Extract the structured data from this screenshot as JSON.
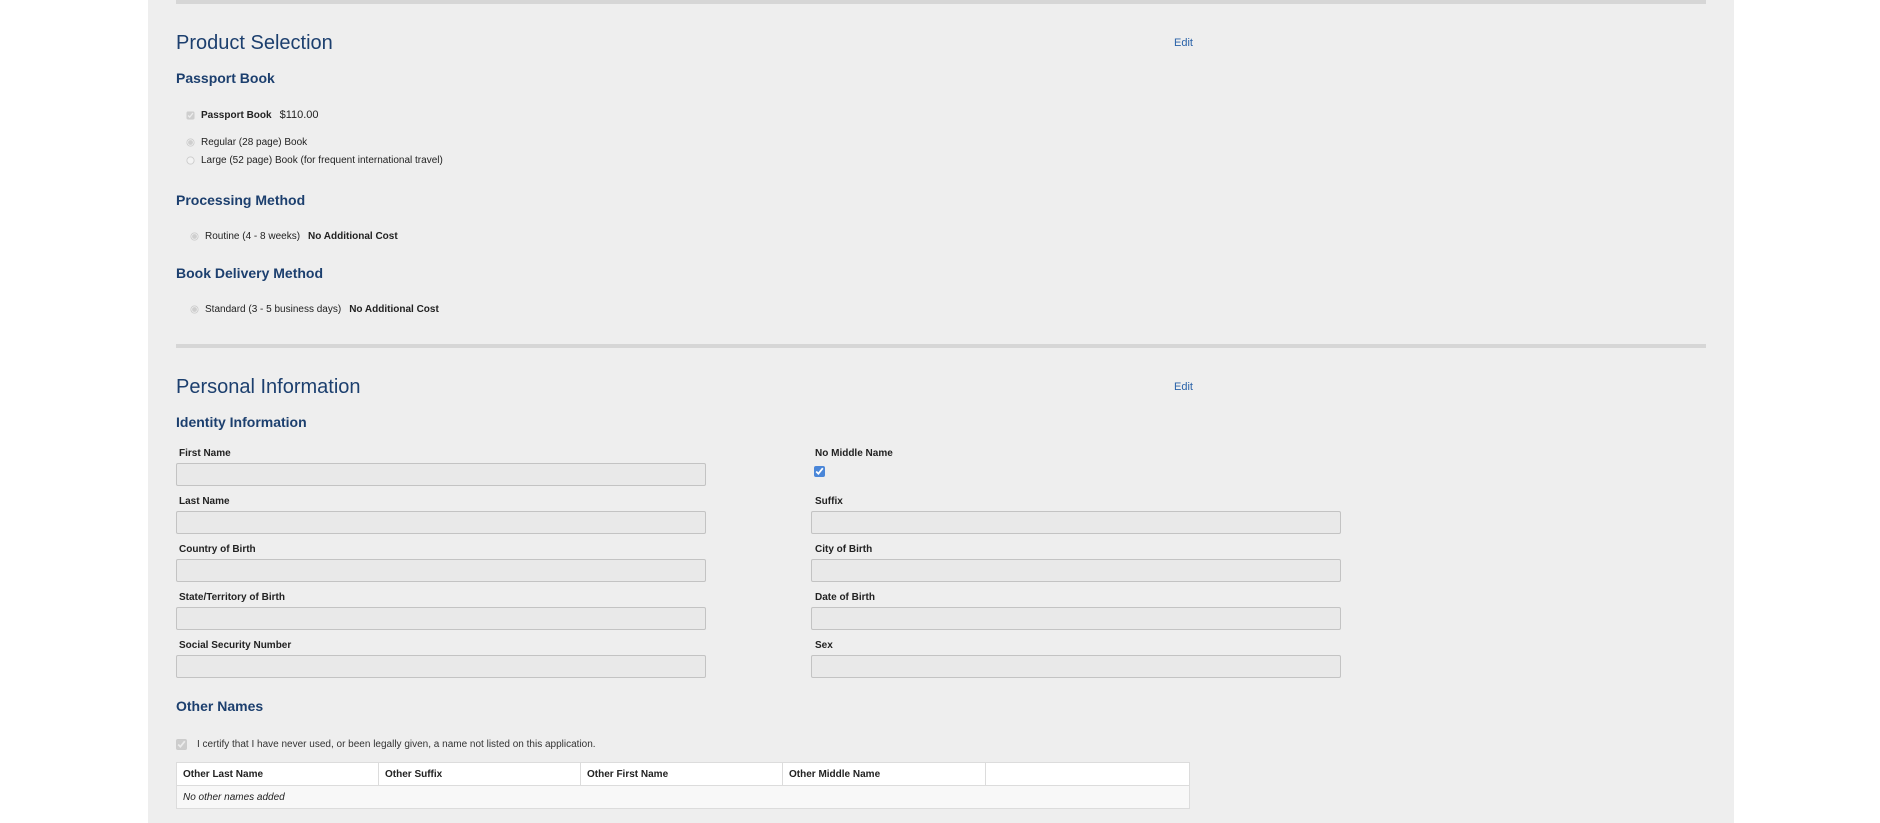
{
  "product_selection": {
    "title": "Product Selection",
    "edit_label": "Edit",
    "passport_book": {
      "title": "Passport Book",
      "item_label": "Passport Book",
      "item_price": "$110.00",
      "options": [
        "Regular (28 page) Book",
        "Large (52 page) Book (for frequent international travel)"
      ]
    },
    "processing_method": {
      "title": "Processing Method",
      "option_label": "Routine (4 - 8 weeks)",
      "option_cost": "No Additional Cost"
    },
    "delivery_method": {
      "title": "Book Delivery Method",
      "option_label": "Standard (3 - 5 business days)",
      "option_cost": "No Additional Cost"
    }
  },
  "personal_information": {
    "title": "Personal Information",
    "edit_label": "Edit",
    "identity": {
      "title": "Identity Information",
      "first_name_label": "First Name",
      "no_middle_name_label": "No Middle Name",
      "last_name_label": "Last Name",
      "suffix_label": "Suffix",
      "country_of_birth_label": "Country of Birth",
      "city_of_birth_label": "City of Birth",
      "state_of_birth_label": "State/Territory of Birth",
      "date_of_birth_label": "Date of Birth",
      "ssn_label": "Social Security Number",
      "sex_label": "Sex"
    },
    "other_names": {
      "title": "Other Names",
      "certify_text": "I certify that I have never used, or been legally given, a name not listed on this application.",
      "columns": [
        "Other Last Name",
        "Other Suffix",
        "Other First Name",
        "Other Middle Name",
        ""
      ],
      "empty_message": "No other names added"
    }
  },
  "colors": {
    "heading": "#1c3f6e",
    "link": "#2a62a8",
    "panel_bg": "#eeeeee",
    "divider": "#d6d6d6"
  }
}
